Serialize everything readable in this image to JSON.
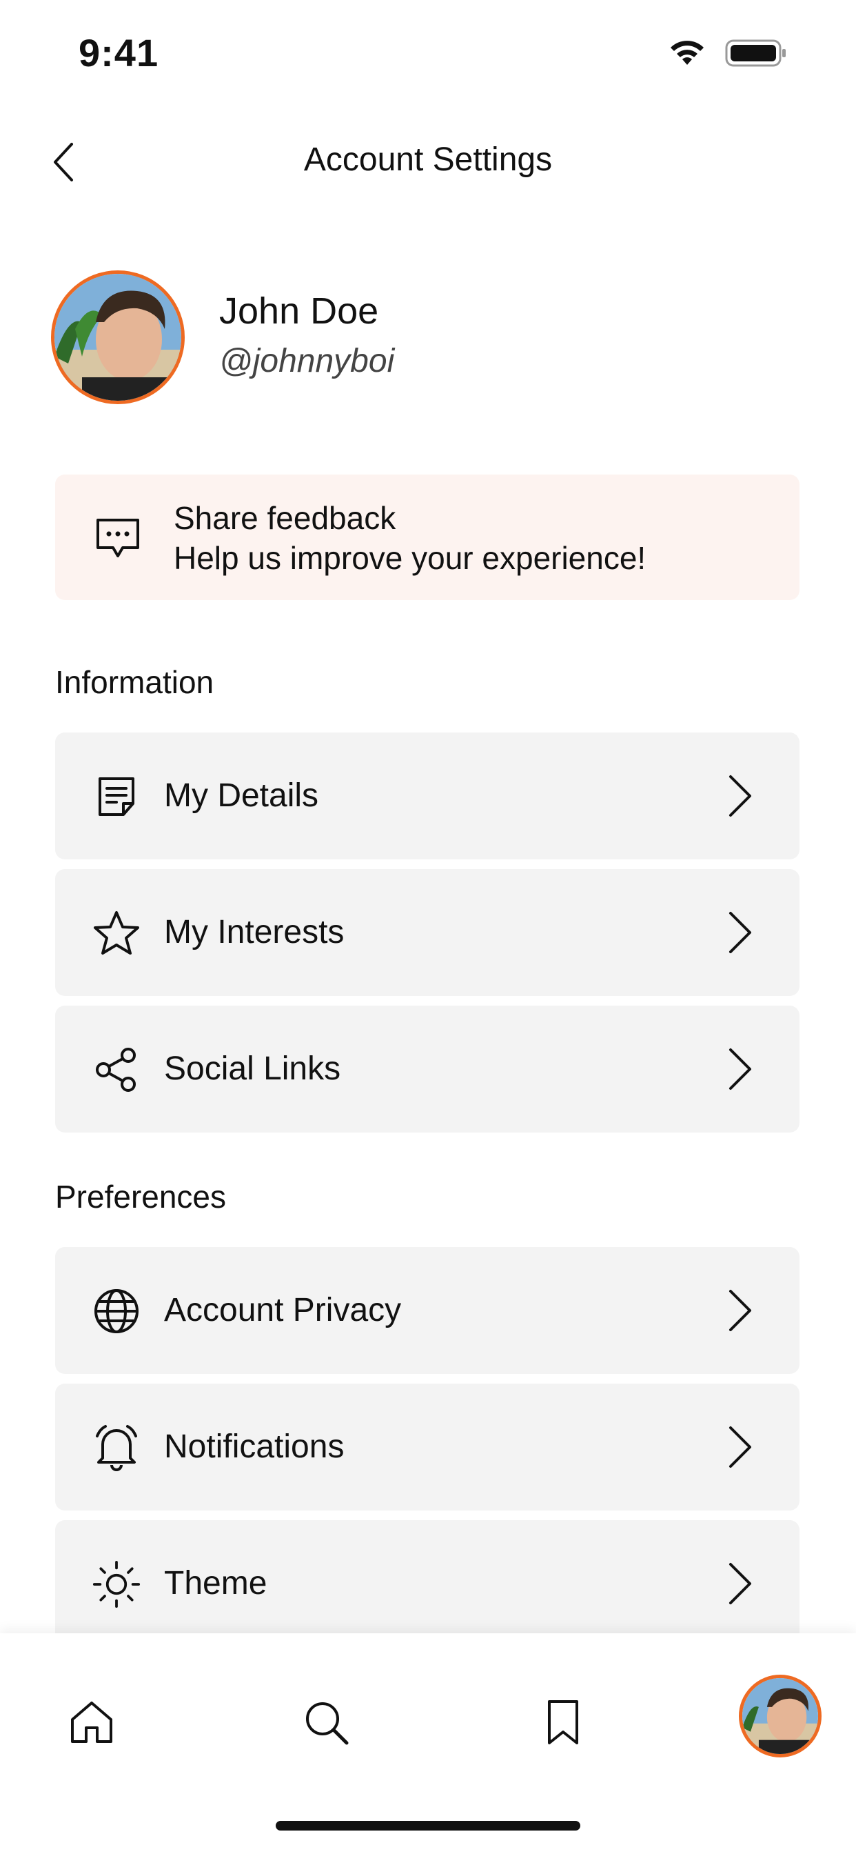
{
  "status": {
    "time": "9:41"
  },
  "header": {
    "title": "Account Settings"
  },
  "profile": {
    "name": "John Doe",
    "handle": "@johnnyboi"
  },
  "feedback": {
    "title": "Share feedback",
    "subtitle": "Help us improve your experience!"
  },
  "sections": [
    {
      "title": "Information",
      "items": [
        {
          "label": "My Details",
          "icon": "document-icon"
        },
        {
          "label": "My Interests",
          "icon": "star-icon"
        },
        {
          "label": "Social Links",
          "icon": "share-icon"
        }
      ]
    },
    {
      "title": "Preferences",
      "items": [
        {
          "label": "Account Privacy",
          "icon": "globe-icon"
        },
        {
          "label": "Notifications",
          "icon": "bell-icon"
        },
        {
          "label": "Theme",
          "icon": "sun-icon"
        }
      ]
    }
  ],
  "bottom_nav": [
    "home-icon",
    "search-icon",
    "bookmark-icon",
    "profile-avatar"
  ],
  "colors": {
    "accent": "#ee6a22",
    "feedback_bg": "#fdf3f0",
    "row_bg": "#f3f3f3"
  }
}
